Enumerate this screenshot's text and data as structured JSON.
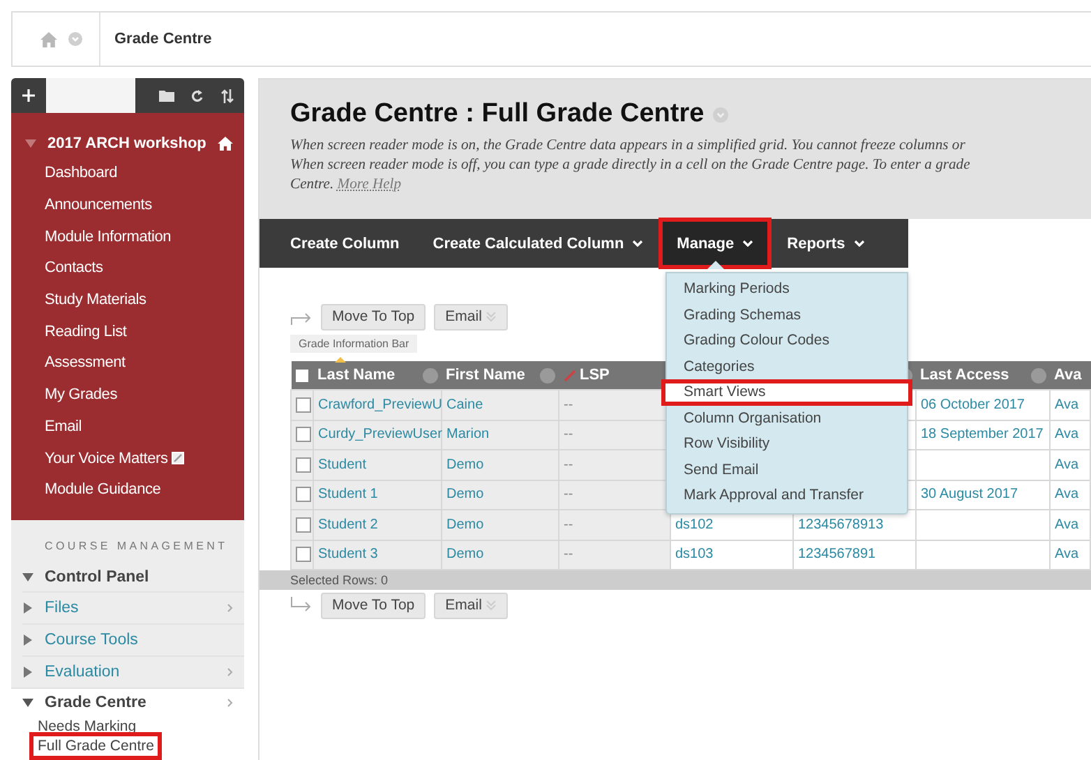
{
  "breadcrumb": {
    "title": "Grade Centre"
  },
  "sidebar": {
    "course_title": "2017 ARCH workshop",
    "items": [
      {
        "label": "Dashboard",
        "kind": "link"
      },
      {
        "label": "Announcements",
        "kind": "link"
      },
      {
        "label": "Module Information",
        "kind": "link"
      },
      {
        "label": "Contacts",
        "kind": "link"
      },
      {
        "label": "Study Materials",
        "kind": "link"
      },
      {
        "label": "Reading List",
        "kind": "link"
      },
      {
        "label": "Assessment",
        "kind": "link"
      },
      {
        "label": "My Grades",
        "kind": "link"
      },
      {
        "label": "Email",
        "kind": "link"
      },
      {
        "label": "Your Voice Matters",
        "kind": "external"
      },
      {
        "label": "Module Guidance",
        "kind": "link"
      }
    ],
    "management_heading": "COURSE MANAGEMENT",
    "control_panel": {
      "label": "Control Panel",
      "expanded": true,
      "children": [
        {
          "label": "Files",
          "expanded": false,
          "has_submenu": true
        },
        {
          "label": "Course Tools",
          "expanded": false,
          "has_submenu": false
        },
        {
          "label": "Evaluation",
          "expanded": false,
          "has_submenu": true
        },
        {
          "label": "Grade Centre",
          "expanded": true,
          "has_submenu": true,
          "children": [
            {
              "label": "Needs Marking",
              "highlighted": false
            },
            {
              "label": "Full Grade Centre",
              "highlighted": true
            }
          ]
        }
      ]
    }
  },
  "page": {
    "title": "Grade Centre : Full Grade Centre",
    "description_lines": [
      "When screen reader mode is on, the Grade Centre data appears in a simplified grid. You cannot freeze columns or",
      "When screen reader mode is off, you can type a grade directly in a cell on the Grade Centre page. To enter a grade",
      "Centre."
    ],
    "help_link": "More Help"
  },
  "toolbar": [
    {
      "label": "Create Column",
      "dropdown": false,
      "highlighted": false,
      "open": false
    },
    {
      "label": "Create Calculated Column",
      "dropdown": true,
      "highlighted": false,
      "open": false
    },
    {
      "label": "Manage",
      "dropdown": true,
      "highlighted": true,
      "open": true
    },
    {
      "label": "Reports",
      "dropdown": true,
      "highlighted": false,
      "open": false
    }
  ],
  "manage_menu": [
    {
      "label": "Marking Periods",
      "highlighted": false
    },
    {
      "label": "Grading Schemas",
      "highlighted": false
    },
    {
      "label": "Grading Colour Codes",
      "highlighted": false
    },
    {
      "label": "Categories",
      "highlighted": false
    },
    {
      "label": "Smart Views",
      "highlighted": true
    },
    {
      "label": "Column Organisation",
      "highlighted": false
    },
    {
      "label": "Row Visibility",
      "highlighted": false
    },
    {
      "label": "Send Email",
      "highlighted": false
    },
    {
      "label": "Mark Approval and Transfer",
      "highlighted": false
    }
  ],
  "top_actions": [
    {
      "label": "Move To Top",
      "dropdown": false
    },
    {
      "label": "Email",
      "dropdown": true
    }
  ],
  "info_bar": "Grade Information Bar",
  "table": {
    "select_all_checked": false,
    "columns": [
      {
        "label": "Last Name",
        "kind": "name",
        "sorted": true,
        "has_menu": true
      },
      {
        "label": "First Name",
        "kind": "name",
        "sorted": false,
        "has_menu": true
      },
      {
        "label": "LSP",
        "kind": "grade",
        "sorted": false,
        "has_menu": false
      },
      {
        "kind": "hidden"
      },
      {
        "kind": "hidden",
        "sorted": false,
        "has_menu": true
      },
      {
        "label": "Last Access",
        "kind": "info",
        "sorted": false,
        "has_menu": true
      },
      {
        "label": "Ava",
        "kind": "info",
        "sorted": false
      }
    ],
    "rows": [
      {
        "checked": false,
        "cells": [
          "Crawford_PreviewU",
          "Caine",
          "--",
          "",
          "",
          "06 October 2017",
          "Ava"
        ]
      },
      {
        "checked": false,
        "cells": [
          "Curdy_PreviewUser",
          "Marion",
          "--",
          "",
          "",
          "18 September 2017",
          "Ava"
        ]
      },
      {
        "checked": false,
        "cells": [
          "Student",
          "Demo",
          "--",
          "",
          "",
          "",
          "Ava"
        ]
      },
      {
        "checked": false,
        "cells": [
          "Student 1",
          "Demo",
          "--",
          "",
          "",
          "30 August 2017",
          "Ava"
        ]
      },
      {
        "checked": false,
        "cells": [
          "Student 2",
          "Demo",
          "--",
          "ds102",
          "12345678913",
          "",
          "Ava"
        ]
      },
      {
        "checked": false,
        "cells": [
          "Student 3",
          "Demo",
          "--",
          "ds103",
          "1234567891",
          "",
          "Ava"
        ]
      }
    ],
    "selected_rows": "Selected Rows: 0"
  },
  "bottom_actions": [
    {
      "label": "Move To Top",
      "dropdown": false
    },
    {
      "label": "Email",
      "dropdown": true
    }
  ]
}
